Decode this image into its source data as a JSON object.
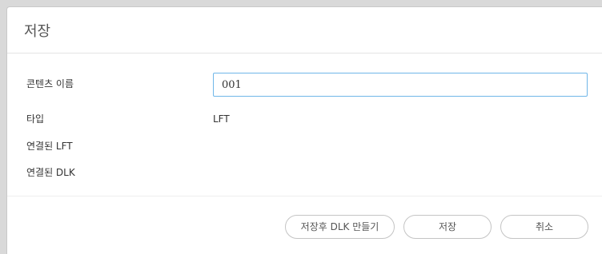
{
  "dialog": {
    "title": "저장"
  },
  "form": {
    "content_name_label": "콘텐츠 이름",
    "content_name_value": "001",
    "type_label": "타입",
    "type_value": "LFT",
    "linked_lft_label": "연결된 LFT",
    "linked_dlk_label": "연결된 DLK"
  },
  "buttons": {
    "save_and_create_dlk": "저장후 DLK 만들기",
    "save": "저장",
    "cancel": "취소"
  },
  "colors": {
    "input_focus_border": "#6fb6e8"
  }
}
